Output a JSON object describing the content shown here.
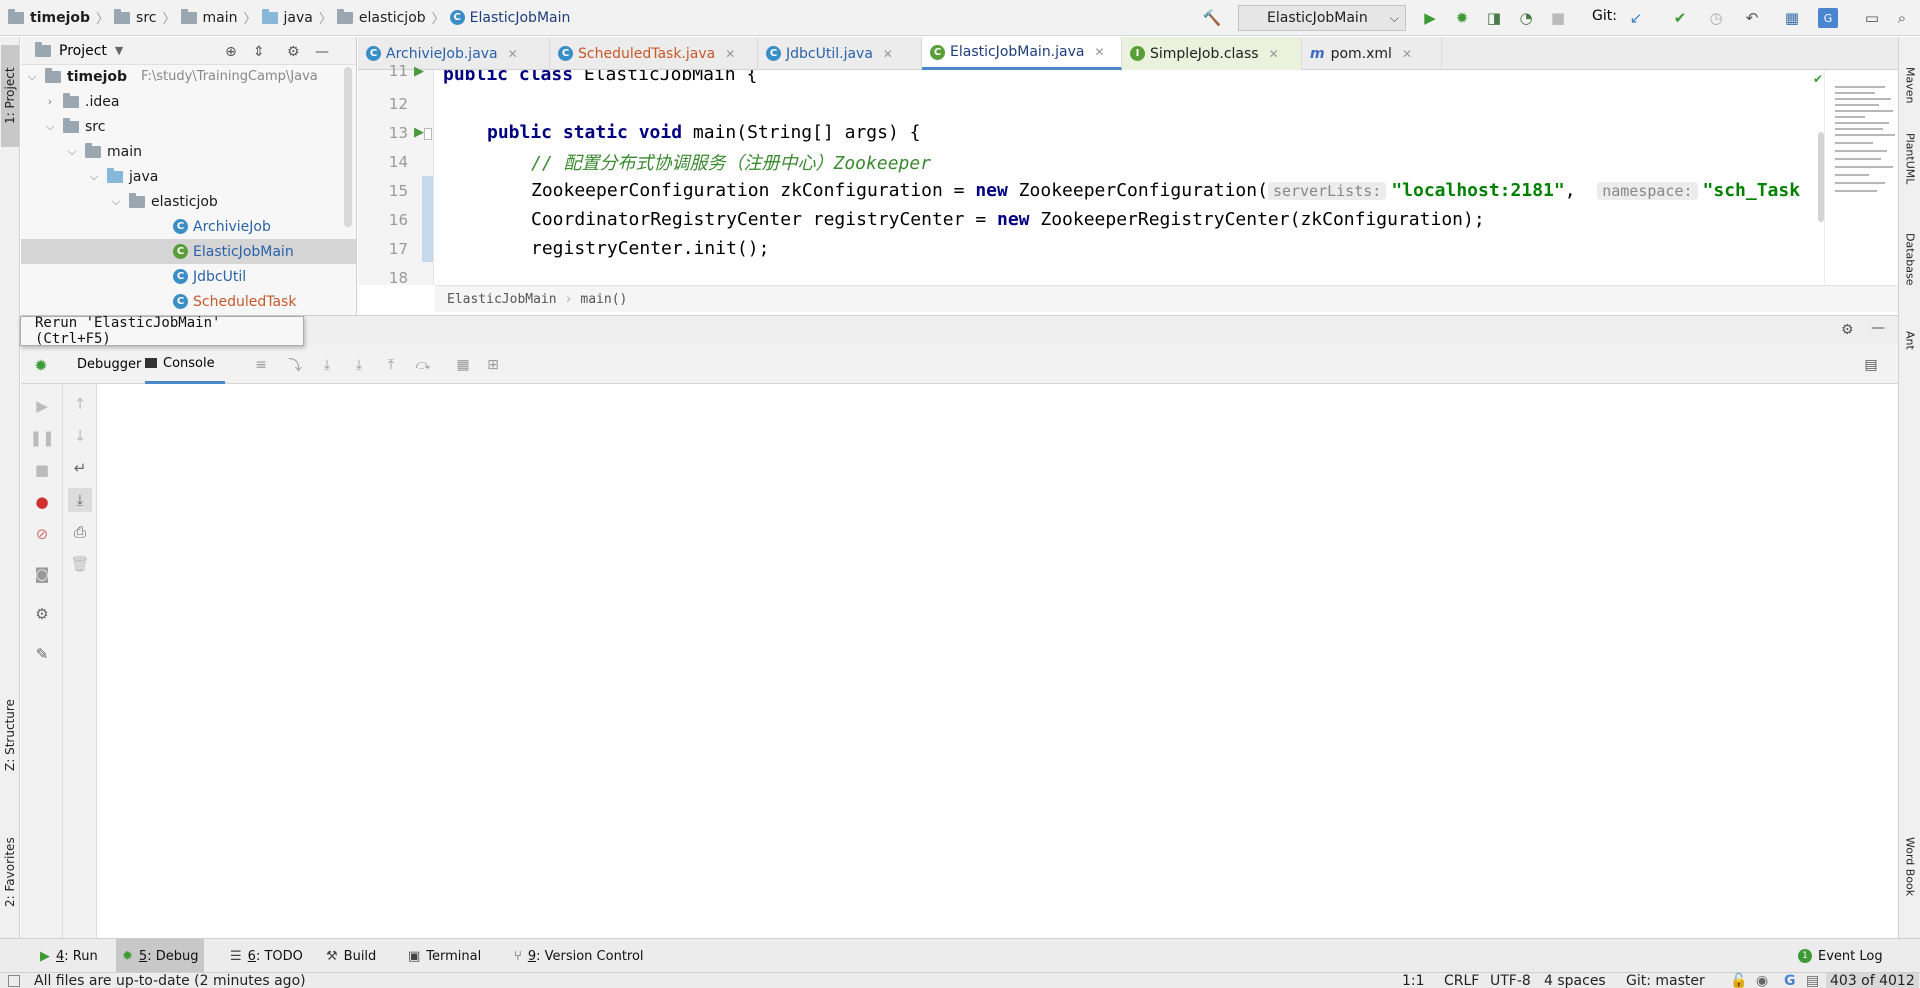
{
  "navbar": {
    "breadcrumbs": [
      "timejob",
      "src",
      "main",
      "java",
      "elasticjob",
      "ElasticJobMain"
    ],
    "run_config": "ElasticJobMain",
    "git_label": "Git:"
  },
  "left_strip": {
    "project": "1: Project",
    "structure": "Z: Structure",
    "favorites": "2: Favorites"
  },
  "right_strip": {
    "maven": "Maven",
    "plantuml": "PlantUML",
    "database": "Database",
    "ant": "Ant",
    "wordbook": "Word Book"
  },
  "project_panel": {
    "title": "Project",
    "root": "timejob",
    "root_path": "F:\\study\\TrainingCamp\\Java",
    "items": [
      {
        "label": ".idea"
      },
      {
        "label": "src"
      },
      {
        "label": "main"
      },
      {
        "label": "java"
      },
      {
        "label": "elasticjob"
      },
      {
        "label": "ArchivieJob"
      },
      {
        "label": "ElasticJobMain"
      },
      {
        "label": "JdbcUtil"
      },
      {
        "label": "ScheduledTask"
      }
    ]
  },
  "editor": {
    "tabs": [
      {
        "label": "ArchivieJob.java"
      },
      {
        "label": "ScheduledTask.java"
      },
      {
        "label": "JdbcUtil.java"
      },
      {
        "label": "ElasticJobMain.java"
      },
      {
        "label": "SimpleJob.class"
      },
      {
        "label": "pom.xml"
      }
    ],
    "line_numbers": [
      "11",
      "12",
      "13",
      "14",
      "15",
      "16",
      "17",
      "18"
    ],
    "code": {
      "l11_kw": "public class",
      "l11_rest": " ElasticJobMain {",
      "l13_kw": "public static void",
      "l13_rest": " main(String[] args) {",
      "l14": "// 配置分布式协调服务（注册中心）Zookeeper",
      "l15_a": "ZookeeperConfiguration zkConfiguration = ",
      "l15_new": "new",
      "l15_b": " ZookeeperConfiguration(",
      "l15_hint1": "serverLists:",
      "l15_str1": "\"localhost:2181\"",
      "l15_comma": ",  ",
      "l15_hint2": "namespace:",
      "l15_str2": "\"sch_Task",
      "l16_a": "CoordinatorRegistryCenter registryCenter = ",
      "l16_new": "new",
      "l16_b": " ZookeeperRegistryCenter(zkConfiguration);",
      "l17": "registryCenter.init();"
    },
    "breadcrumb": [
      "ElasticJobMain",
      "main()"
    ]
  },
  "debug": {
    "tooltip": "Rerun 'ElasticJobMain' (Ctrl+F5)",
    "tabs": [
      {
        "label": "Debugger"
      },
      {
        "label": "Console"
      }
    ]
  },
  "tool_windows": [
    {
      "num": "4",
      "label": ": Run"
    },
    {
      "num": "5",
      "label": ": Debug"
    },
    {
      "num": "6",
      "label": ": TODO"
    },
    {
      "num": "",
      "label": "Build"
    },
    {
      "num": "",
      "label": "Terminal"
    },
    {
      "num": "9",
      "label": ": Version Control"
    }
  ],
  "event_log": "Event Log",
  "status": {
    "message": "All files are up-to-date (2 minutes ago)",
    "position": "1:1",
    "line_sep": "CRLF",
    "encoding": "UTF-8",
    "indent": "4 spaces",
    "git": "Git: master",
    "memory": "403 of 4012"
  }
}
